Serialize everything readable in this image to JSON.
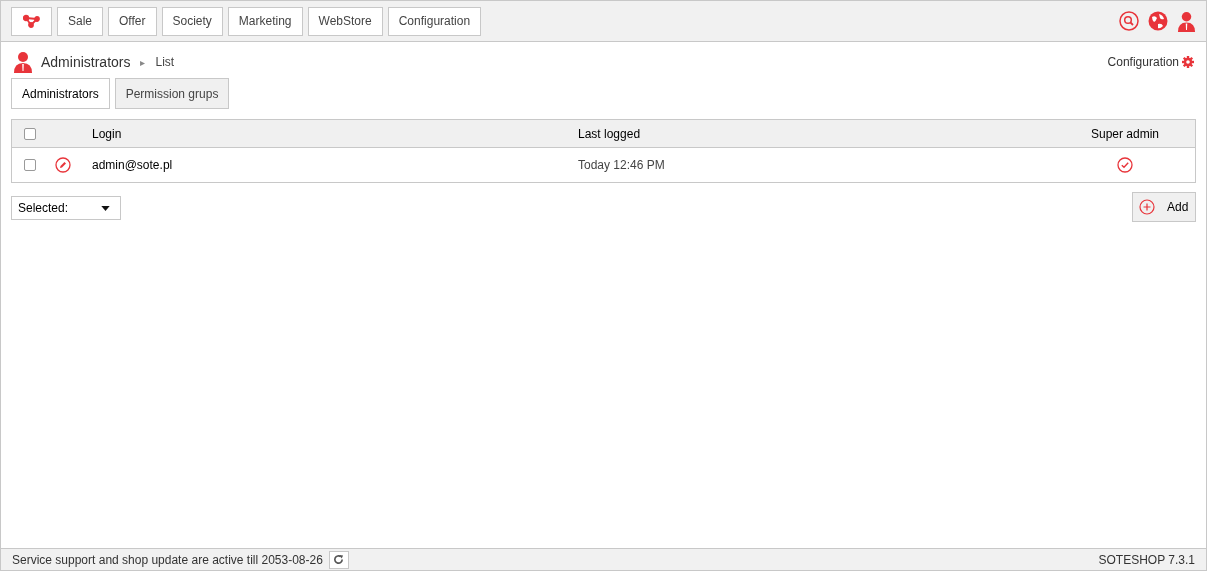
{
  "top_menu": [
    {
      "label": "Sale"
    },
    {
      "label": "Offer"
    },
    {
      "label": "Society"
    },
    {
      "label": "Marketing"
    },
    {
      "label": "WebStore"
    },
    {
      "label": "Configuration"
    }
  ],
  "breadcrumb": {
    "section": "Administrators",
    "separator": "▸",
    "page": "List"
  },
  "config_link": "Configuration",
  "tabs": [
    {
      "label": "Administrators",
      "selected": true
    },
    {
      "label": "Permission grups",
      "selected": false
    }
  ],
  "table": {
    "columns": [
      "Login",
      "Last logged",
      "Super admin"
    ],
    "all_checked": false,
    "rows": [
      {
        "checked": false,
        "login": "admin@sote.pl",
        "last_logged": "Today 12:46 PM",
        "super_admin": true
      }
    ]
  },
  "bulk_select": {
    "value": "Selected:"
  },
  "add_button": "Add",
  "status_bar": {
    "message": "Service support and shop update are active till 2053-08-26",
    "version": "SOTESHOP 7.3.1"
  }
}
